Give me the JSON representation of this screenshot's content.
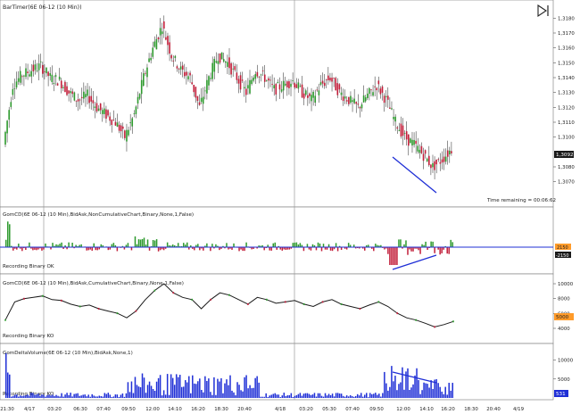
{
  "window": {
    "play_icon": "play-bar-icon"
  },
  "colors": {
    "up_candle": "#2e9a2e",
    "down_candle": "#c21e3a",
    "line": "#1a1a1a",
    "grid": "#9a9a9a",
    "trend_line": "#1f2fd6",
    "volume_bar": "#1f2fd6",
    "label_bg": "#1a1a1a",
    "label_orange": "#ff9b2a"
  },
  "chart_data": [
    {
      "type": "candlestick",
      "title": "BarTimer(6E 06-12 (10 Min))",
      "ylim": [
        1.3065,
        1.3185
      ],
      "yticks": [
        "1,3180",
        "1,3170",
        "1,3160",
        "1,3150",
        "1,3140",
        "1,3130",
        "1,3120",
        "1,3110",
        "1,3100",
        "1,3080",
        "1,3070"
      ],
      "last_price_label": "1,3092",
      "annotation": "Time remaining = 00:06:62",
      "approx_closes": [
        1.3095,
        1.3135,
        1.3142,
        1.3145,
        1.3148,
        1.314,
        1.3138,
        1.313,
        1.3125,
        1.3128,
        1.312,
        1.3115,
        1.311,
        1.31,
        1.3115,
        1.314,
        1.316,
        1.3175,
        1.3155,
        1.3145,
        1.314,
        1.312,
        1.314,
        1.3155,
        1.315,
        1.314,
        1.313,
        1.3145,
        1.314,
        1.3132,
        1.3135,
        1.3138,
        1.313,
        1.3125,
        1.3135,
        1.314,
        1.313,
        1.3125,
        1.312,
        1.3128,
        1.3135,
        1.3125,
        1.311,
        1.31,
        1.3095,
        1.3088,
        1.308,
        1.3085,
        1.3092
      ]
    },
    {
      "type": "bar",
      "title": "GomCD(6E 06-12 (10 Min),BidAsk,NonCumulativeChart,Binary,None,1,False)",
      "subtitle": "Recording Binary OK",
      "ytick_top": "2150",
      "ytick_bottom": "-2150"
    },
    {
      "type": "line",
      "title": "GomCD(6E 06-12 (10 Min),BidAsk,CumulativeChart,Binary,None,1,False)",
      "subtitle": "Recording Binary KO",
      "yticks": [
        "10000",
        "8000",
        "6000",
        "4000"
      ],
      "last_label": "5000"
    },
    {
      "type": "bar",
      "title": "GomDeltaVolume(6E 06-12 (10 Min),BidAsk,None,1)",
      "subtitle": "Recording Binary KO",
      "yticks": [
        "10000",
        "5000"
      ],
      "last_label": "531"
    }
  ],
  "x_axis": {
    "labels": [
      "21:30",
      "4/17",
      "03:20",
      "06:30",
      "07:40",
      "09:50",
      "12:00",
      "14:10",
      "16:20",
      "18:30",
      "20:40",
      "4/18",
      "03:20",
      "05:30",
      "07:40",
      "09:50",
      "12:00",
      "14:10",
      "16:20",
      "18:30",
      "20:40",
      "4/19"
    ]
  }
}
